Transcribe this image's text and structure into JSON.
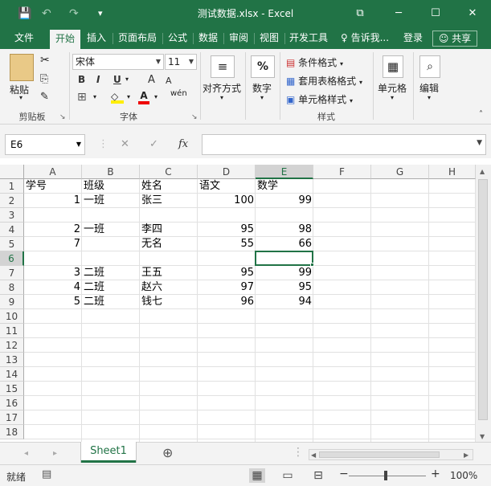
{
  "window": {
    "title": "测试数据.xlsx - Excel",
    "save_icon": "💾",
    "undo_icon": "↶",
    "redo_icon": "↷",
    "qat_more": "▾",
    "ribbon_display": "⧉",
    "minimize": "─",
    "maximize": "☐",
    "close": "✕"
  },
  "menu": {
    "tabs": [
      {
        "label": "文件"
      },
      {
        "label": "开始"
      },
      {
        "label": "插入"
      },
      {
        "label": "页面布局"
      },
      {
        "label": "公式"
      },
      {
        "label": "数据"
      },
      {
        "label": "审阅"
      },
      {
        "label": "视图"
      },
      {
        "label": "开发工具"
      }
    ],
    "tell_me": "告诉我...",
    "login": "登录",
    "share": "共享"
  },
  "ribbon": {
    "clipboard": {
      "paste": "粘贴",
      "group": "剪贴板"
    },
    "font": {
      "name": "宋体",
      "size": "11",
      "bold": "B",
      "italic": "I",
      "underline": "U",
      "grow": "A",
      "shrink": "A",
      "phonetic": "wén",
      "group": "字体"
    },
    "alignment": {
      "label": "对齐方式"
    },
    "number": {
      "label": "数字",
      "icon": "%"
    },
    "styles": {
      "conditional": "条件格式",
      "table": "套用表格格式",
      "cell_styles": "单元格样式",
      "group": "样式"
    },
    "cells": {
      "label": "单元格"
    },
    "editing": {
      "label": "编辑"
    }
  },
  "formula_bar": {
    "name_box": "E6",
    "cancel": "✕",
    "enter": "✓",
    "fx": "fx",
    "value": ""
  },
  "grid": {
    "columns": [
      "A",
      "B",
      "C",
      "D",
      "E",
      "F",
      "G",
      "H"
    ],
    "rows": [
      "1",
      "2",
      "3",
      "4",
      "5",
      "6",
      "7",
      "8",
      "9",
      "10",
      "11",
      "12",
      "13",
      "14",
      "15",
      "16",
      "17",
      "18"
    ],
    "selected_col": "E",
    "selected_row": "6",
    "cells": [
      {
        "r": 0,
        "c": 0,
        "v": "学号",
        "t": "text"
      },
      {
        "r": 0,
        "c": 1,
        "v": "班级",
        "t": "text"
      },
      {
        "r": 0,
        "c": 2,
        "v": "姓名",
        "t": "text"
      },
      {
        "r": 0,
        "c": 3,
        "v": "语文",
        "t": "text"
      },
      {
        "r": 0,
        "c": 4,
        "v": "数学",
        "t": "text"
      },
      {
        "r": 1,
        "c": 0,
        "v": "1",
        "t": "num"
      },
      {
        "r": 1,
        "c": 1,
        "v": "一班",
        "t": "text"
      },
      {
        "r": 1,
        "c": 2,
        "v": "张三",
        "t": "text"
      },
      {
        "r": 1,
        "c": 3,
        "v": "100",
        "t": "num"
      },
      {
        "r": 1,
        "c": 4,
        "v": "99",
        "t": "num"
      },
      {
        "r": 3,
        "c": 0,
        "v": "2",
        "t": "num"
      },
      {
        "r": 3,
        "c": 1,
        "v": "一班",
        "t": "text"
      },
      {
        "r": 3,
        "c": 2,
        "v": "李四",
        "t": "text"
      },
      {
        "r": 3,
        "c": 3,
        "v": "95",
        "t": "num"
      },
      {
        "r": 3,
        "c": 4,
        "v": "98",
        "t": "num"
      },
      {
        "r": 4,
        "c": 0,
        "v": "7",
        "t": "num"
      },
      {
        "r": 4,
        "c": 2,
        "v": "无名",
        "t": "text"
      },
      {
        "r": 4,
        "c": 3,
        "v": "55",
        "t": "num"
      },
      {
        "r": 4,
        "c": 4,
        "v": "66",
        "t": "num"
      },
      {
        "r": 6,
        "c": 0,
        "v": "3",
        "t": "num"
      },
      {
        "r": 6,
        "c": 1,
        "v": "二班",
        "t": "text"
      },
      {
        "r": 6,
        "c": 2,
        "v": "王五",
        "t": "text"
      },
      {
        "r": 6,
        "c": 3,
        "v": "95",
        "t": "num"
      },
      {
        "r": 6,
        "c": 4,
        "v": "99",
        "t": "num"
      },
      {
        "r": 7,
        "c": 0,
        "v": "4",
        "t": "num"
      },
      {
        "r": 7,
        "c": 1,
        "v": "二班",
        "t": "text"
      },
      {
        "r": 7,
        "c": 2,
        "v": "赵六",
        "t": "text"
      },
      {
        "r": 7,
        "c": 3,
        "v": "97",
        "t": "num"
      },
      {
        "r": 7,
        "c": 4,
        "v": "95",
        "t": "num"
      },
      {
        "r": 8,
        "c": 0,
        "v": "5",
        "t": "num"
      },
      {
        "r": 8,
        "c": 1,
        "v": "二班",
        "t": "text"
      },
      {
        "r": 8,
        "c": 2,
        "v": "钱七",
        "t": "text"
      },
      {
        "r": 8,
        "c": 3,
        "v": "96",
        "t": "num"
      },
      {
        "r": 8,
        "c": 4,
        "v": "94",
        "t": "num"
      }
    ]
  },
  "sheets": {
    "tabs": [
      {
        "label": "Sheet1"
      }
    ],
    "add": "⊕",
    "prev": "◂",
    "next": "▸"
  },
  "status": {
    "ready": "就绪",
    "zoom": "100%",
    "zoom_minus": "−",
    "zoom_plus": "+"
  }
}
